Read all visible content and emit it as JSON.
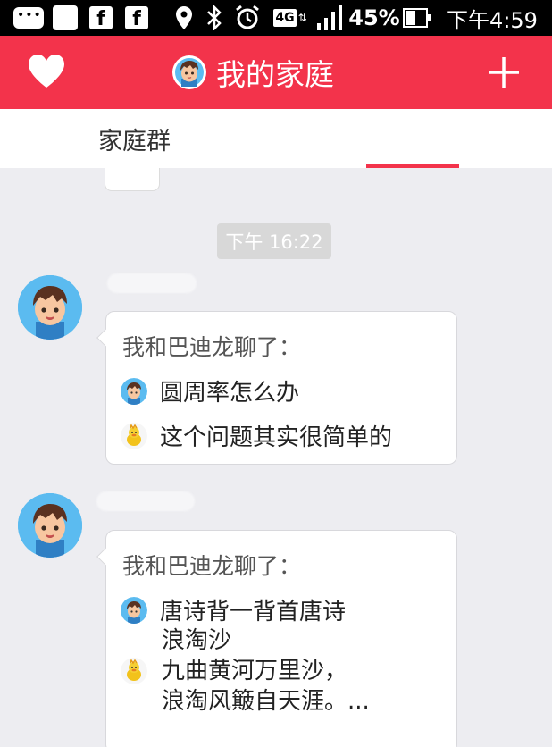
{
  "status_bar": {
    "fb1": "f",
    "fb2": "f",
    "network": "4G",
    "battery": "45%",
    "time": "下午4:59"
  },
  "header": {
    "title": "我的家庭",
    "left_icon": "heart-icon",
    "right_icon": "plus-icon",
    "color": "#f3334b"
  },
  "group_bar": {
    "label": "家庭群"
  },
  "chat": {
    "timestamp": "下午 16:22",
    "messages": [
      {
        "heading": "我和巴迪龙聊了：",
        "question": "圆周率怎么办",
        "answer": "这个问题其实很简单的"
      },
      {
        "heading": "我和巴迪龙聊了：",
        "question": "唐诗背一背首唐诗",
        "answer_lines": [
          "浪淘沙",
          "九曲黄河万里沙，",
          "浪淘风簸自天涯。..."
        ]
      }
    ]
  }
}
